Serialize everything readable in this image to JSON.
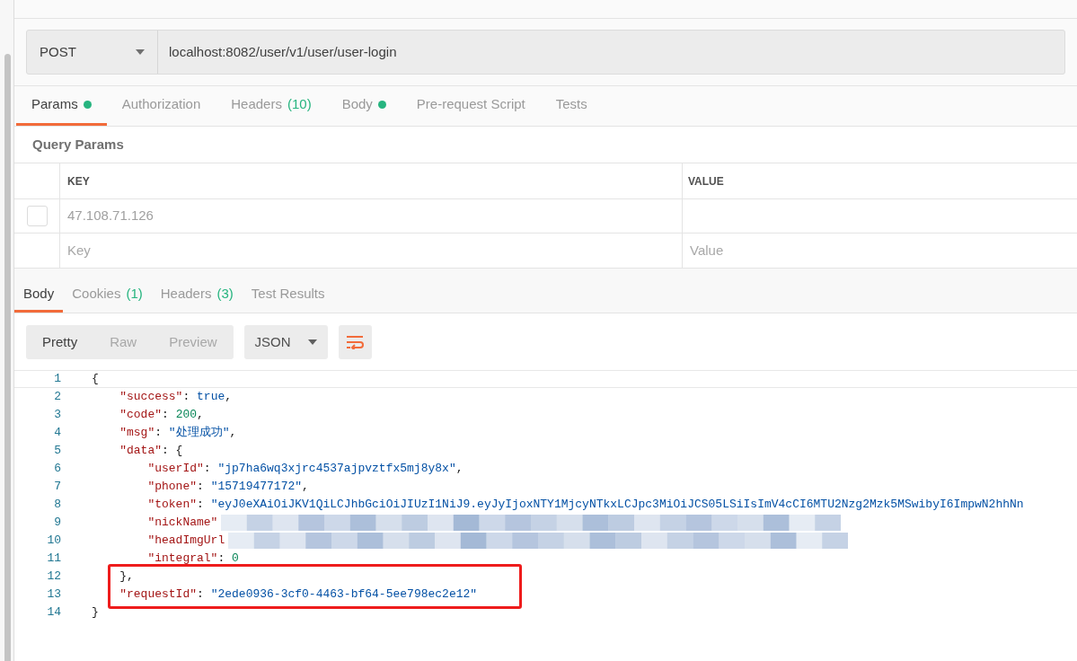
{
  "request": {
    "method": "POST",
    "url": "localhost:8082/user/v1/user/user-login"
  },
  "request_tabs": [
    {
      "label": "Params",
      "dot": true,
      "selected": true
    },
    {
      "label": "Authorization",
      "dot": false,
      "selected": false
    },
    {
      "label": "Headers",
      "count": "(10)",
      "dot": false,
      "selected": false
    },
    {
      "label": "Body",
      "dot": true,
      "selected": false
    },
    {
      "label": "Pre-request Script",
      "dot": false,
      "selected": false
    },
    {
      "label": "Tests",
      "dot": false,
      "selected": false
    }
  ],
  "query_params": {
    "title": "Query Params",
    "columns": [
      "KEY",
      "VALUE"
    ],
    "rows": [
      {
        "key": "47.108.71.126",
        "checked": false
      }
    ],
    "new_row": {
      "key": {
        "placeholder": "Key"
      },
      "value": {
        "placeholder": "Value"
      }
    }
  },
  "response_tabs": [
    {
      "label": "Body",
      "selected": true
    },
    {
      "label": "Cookies",
      "count": "(1)",
      "selected": false
    },
    {
      "label": "Headers",
      "count": "(3)",
      "selected": false
    },
    {
      "label": "Test Results",
      "selected": false
    }
  ],
  "view_modes": [
    {
      "label": "Pretty",
      "selected": true
    },
    {
      "label": "Raw",
      "selected": false
    },
    {
      "label": "Preview",
      "selected": false
    }
  ],
  "format": "JSON",
  "code": [
    {
      "number": "1",
      "tokens": [
        {
          "kind": "punct",
          "text": "{"
        }
      ]
    },
    {
      "number": "2",
      "tokens": [
        {
          "kind": "key",
          "text": "    \"success\""
        },
        {
          "kind": "punct",
          "text": ": "
        },
        {
          "kind": "bool",
          "text": "true"
        },
        {
          "kind": "punct",
          "text": ","
        }
      ]
    },
    {
      "number": "3",
      "tokens": [
        {
          "kind": "key",
          "text": "    \"code\""
        },
        {
          "kind": "punct",
          "text": ": "
        },
        {
          "kind": "number",
          "text": "200"
        },
        {
          "kind": "punct",
          "text": ","
        }
      ]
    },
    {
      "number": "4",
      "tokens": [
        {
          "kind": "key",
          "text": "    \"msg\""
        },
        {
          "kind": "punct",
          "text": ": "
        },
        {
          "kind": "string",
          "text": "\"处理成功\""
        },
        {
          "kind": "punct",
          "text": ","
        }
      ]
    },
    {
      "number": "5",
      "tokens": [
        {
          "kind": "key",
          "text": "    \"data\""
        },
        {
          "kind": "punct",
          "text": ": {"
        }
      ]
    },
    {
      "number": "6",
      "tokens": [
        {
          "kind": "key",
          "text": "        \"userId\""
        },
        {
          "kind": "punct",
          "text": ": "
        },
        {
          "kind": "string",
          "text": "\"jp7ha6wq3xjrc4537ajpvztfx5mj8y8x\""
        },
        {
          "kind": "punct",
          "text": ","
        }
      ]
    },
    {
      "number": "7",
      "tokens": [
        {
          "kind": "key",
          "text": "        \"phone\""
        },
        {
          "kind": "punct",
          "text": ": "
        },
        {
          "kind": "string",
          "text": "\"15719477172\""
        },
        {
          "kind": "punct",
          "text": ","
        }
      ]
    },
    {
      "number": "8",
      "tokens": [
        {
          "kind": "key",
          "text": "        \"token\""
        },
        {
          "kind": "punct",
          "text": ": "
        },
        {
          "kind": "string",
          "text": "\"eyJ0eXAiOiJKV1QiLCJhbGciOiJIUzI1NiJ9.eyJyIjoxNTY1MjcyNTkxLCJpc3MiOiJCS05LSiIsImV4cCI6MTU2Nzg2Mzk5MSwibyI6ImpwN2hhNn"
        }
      ]
    },
    {
      "number": "9",
      "redacted": true,
      "tokens": [
        {
          "kind": "key",
          "text": "        \"nickName\""
        }
      ]
    },
    {
      "number": "10",
      "redacted": true,
      "tokens": [
        {
          "kind": "key",
          "text": "        \"headImgUrl"
        }
      ]
    },
    {
      "number": "11",
      "tokens": [
        {
          "kind": "key",
          "text": "        \"integral\""
        },
        {
          "kind": "punct",
          "text": ": "
        },
        {
          "kind": "number",
          "text": "0"
        }
      ]
    },
    {
      "number": "12",
      "boxed": true,
      "tokens": [
        {
          "kind": "punct",
          "text": "    },"
        }
      ]
    },
    {
      "number": "13",
      "boxed": true,
      "tokens": [
        {
          "kind": "key",
          "text": "    \"requestId\""
        },
        {
          "kind": "punct",
          "text": ": "
        },
        {
          "kind": "string",
          "text": "\"2ede0936-3cf0-4463-bf64-5ee798ec2e12\""
        }
      ]
    },
    {
      "number": "14",
      "tokens": [
        {
          "kind": "punct",
          "text": "}"
        }
      ]
    }
  ]
}
